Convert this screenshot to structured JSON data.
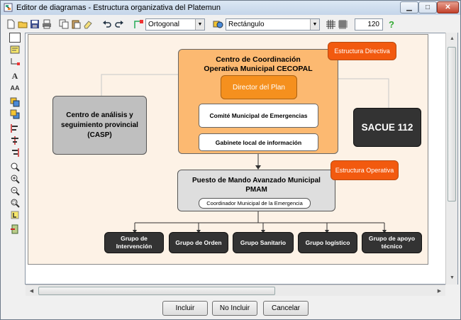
{
  "window": {
    "title": "Editor de diagramas - Estructura organizativa del Platemun",
    "min_glyph": "▁",
    "max_glyph": "□",
    "close_glyph": "✕"
  },
  "toolbar": {
    "connector_style": "Ortogonal",
    "shape_type": "Rectángulo",
    "zoom_value": "120",
    "help_glyph": "?"
  },
  "diagram": {
    "cecopal_title": "Centro de Coordinación Operativa Municipal CECOPAL",
    "badge_directiva": "Estructura Directiva",
    "director": "Director del Plan",
    "comite": "Comité Municipal de Emergencias",
    "gabinete": "Gabinete local de información",
    "casp": "Centro de análisis y seguimiento provincial (CASP)",
    "sacue": "SACUE 112",
    "pma_title": "Puesto de Mando Avanzado Municipal PMAM",
    "badge_operativa": "Estructura Operativa",
    "coordinador": "Coordinador Municipal de la Emergencia",
    "groups": [
      "Grupo de Intervención",
      "Grupo de Orden",
      "Grupo Sanitario",
      "Grupo logístico",
      "Grupo de apoyo técnico"
    ]
  },
  "buttons": {
    "incluir": "Incluir",
    "no_incluir": "No Incluir",
    "cancelar": "Cancelar"
  },
  "colors": {
    "cecopal_fill": "#fcb971",
    "director_fill": "#f5901e",
    "badge_fill": "#f25a0f",
    "casp_fill": "#bfbfbf",
    "dark_fill": "#333333",
    "pma_fill": "#dedede",
    "diagram_bg": "#fdf2e6"
  }
}
